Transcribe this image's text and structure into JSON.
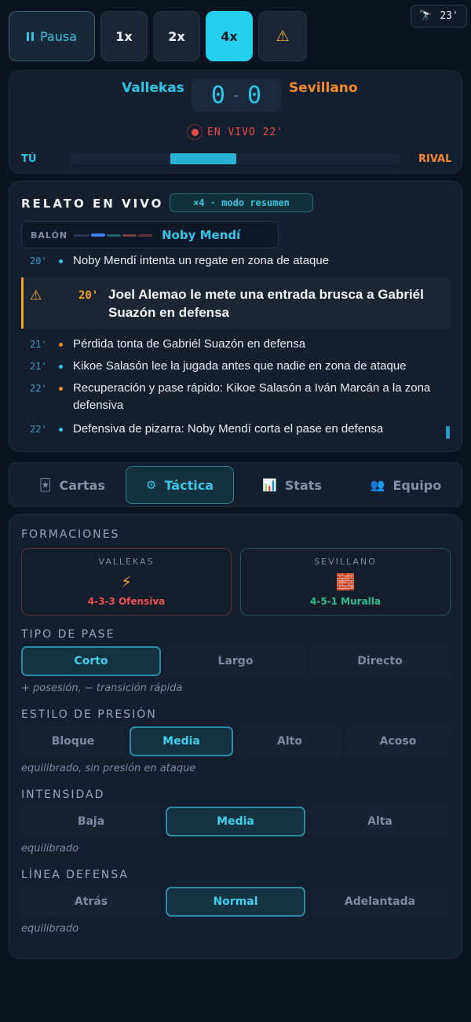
{
  "controls": {
    "pause_label": "Pausa",
    "speeds": [
      "1x",
      "2x",
      "4x"
    ],
    "active_speed": "4x",
    "alert_icon": "warning-icon"
  },
  "weather": {
    "icon": "telescope-icon",
    "minute": "23'"
  },
  "match": {
    "home": "Vallekas",
    "away": "Sevillano",
    "home_score": "0",
    "away_score": "0",
    "status": "EN VIVO 22'",
    "you_label": "TÚ",
    "rival_label": "RIVAL",
    "home_color": "#2ec5e6",
    "away_color": "#f58a2b"
  },
  "feed": {
    "title": "RELATO EN VIVO",
    "badge": "×4 · modo resumen",
    "ball_label": "BALÓN",
    "ball_holder": "Noby Mendí",
    "events": [
      {
        "minute": "20'",
        "text": "Noby Mendí intenta un regate en zona de ataque",
        "team": "home"
      },
      {
        "minute": "20'",
        "text": "Joel Alemao le mete una entrada brusca a Gabriél Suazón en defensa",
        "highlight": true
      },
      {
        "minute": "21'",
        "text": "Pérdida tonta de Gabriél Suazón en defensa",
        "team": "away"
      },
      {
        "minute": "21'",
        "text": "Kikoe Salasón lee la jugada antes que nadie en zona de ataque",
        "team": "home"
      },
      {
        "minute": "22'",
        "text": "Recuperación y pase rápido: Kikoe Salasón a Iván Marcán a la zona defensiva",
        "team": "away"
      },
      {
        "minute": "22'",
        "text": "Defensiva de pizarra: Noby Mendí corta el pase en defensa",
        "team": "home"
      }
    ]
  },
  "tabs": [
    {
      "label": "Cartas",
      "icon": "cards-icon"
    },
    {
      "label": "Táctica",
      "icon": "gear-icon",
      "active": true
    },
    {
      "label": "Stats",
      "icon": "bar-chart-icon"
    },
    {
      "label": "Equipo",
      "icon": "people-icon"
    }
  ],
  "tactics": {
    "formations_title": "FORMACIONES",
    "home_team": "VALLEKAS",
    "home_icon": "lightning-icon",
    "home_formation": "4-3-3 Ofensiva",
    "away_team": "SEVILLANO",
    "away_icon": "brick-wall-icon",
    "away_formation": "4-5-1 Muralla",
    "pass_title": "TIPO DE PASE",
    "pass_options": [
      "Corto",
      "Largo",
      "Directo"
    ],
    "pass_selected": "Corto",
    "pass_hint": "+ posesión, − transición rápida",
    "press_title": "ESTILO DE PRESIÓN",
    "press_options": [
      "Bloque",
      "Media",
      "Alto",
      "Acoso"
    ],
    "press_selected": "Media",
    "press_hint": "equilibrado, sin presión en ataque",
    "intensity_title": "INTENSIDAD",
    "intensity_options": [
      "Baja",
      "Media",
      "Alta"
    ],
    "intensity_selected": "Media",
    "intensity_hint": "equilibrado",
    "line_title": "LÍNEA DEFENSA",
    "line_options": [
      "Atrás",
      "Normal",
      "Adelantada"
    ],
    "line_selected": "Normal",
    "line_hint": "equilibrado"
  }
}
